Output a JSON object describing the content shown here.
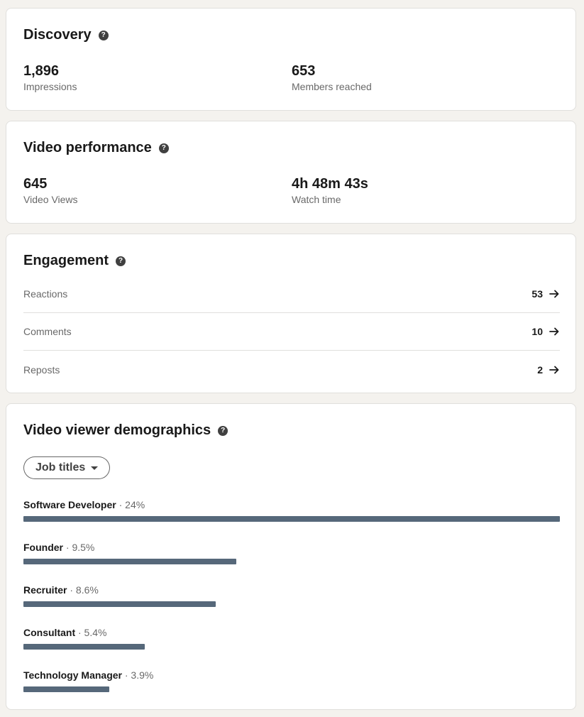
{
  "discovery": {
    "title": "Discovery",
    "impressions_value": "1,896",
    "impressions_label": "Impressions",
    "members_value": "653",
    "members_label": "Members reached"
  },
  "video_performance": {
    "title": "Video performance",
    "views_value": "645",
    "views_label": "Video Views",
    "watch_value": "4h 48m 43s",
    "watch_label": "Watch time"
  },
  "engagement": {
    "title": "Engagement",
    "rows": [
      {
        "label": "Reactions",
        "count": "53"
      },
      {
        "label": "Comments",
        "count": "10"
      },
      {
        "label": "Reposts",
        "count": "2"
      }
    ]
  },
  "demographics": {
    "title": "Video viewer demographics",
    "dropdown_label": "Job titles",
    "rows": [
      {
        "name": "Software Developer",
        "pct_text": " · 24%",
        "fraction": 1.0
      },
      {
        "name": "Founder",
        "pct_text": " · 9.5%",
        "fraction": 0.397
      },
      {
        "name": "Recruiter",
        "pct_text": " · 8.6%",
        "fraction": 0.358
      },
      {
        "name": "Consultant",
        "pct_text": " · 5.4%",
        "fraction": 0.226
      },
      {
        "name": "Technology Manager",
        "pct_text": " · 3.9%",
        "fraction": 0.16
      }
    ]
  },
  "icons": {
    "help": "help-circle-icon",
    "arrow": "arrow-right-icon",
    "caret": "caret-down-icon"
  },
  "colors": {
    "bar": "#56687a",
    "background": "#f4f2ee"
  }
}
